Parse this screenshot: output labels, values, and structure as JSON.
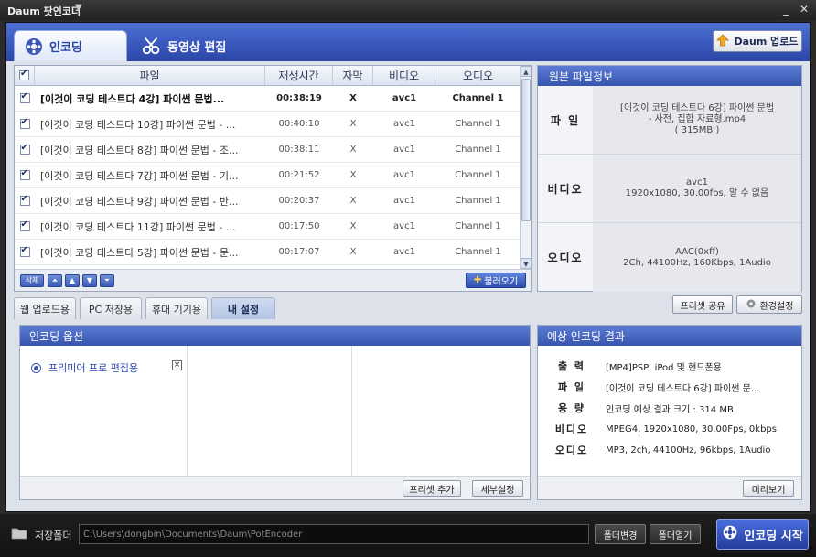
{
  "window": {
    "title": "Daum 팟인코더",
    "minimize": "_",
    "close": "✕"
  },
  "main_tabs": [
    {
      "label": "인코딩",
      "active": true
    },
    {
      "label": "동영상 편집",
      "active": false
    }
  ],
  "upload_button": "Daum 업로드",
  "file_list": {
    "columns": [
      "파일",
      "재생시간",
      "자막",
      "비디오",
      "오디오"
    ],
    "rows": [
      {
        "file": "[이것이 코딩 테스트다 4강] 파이썬 문법...",
        "time": "00:38:19",
        "sub": "X",
        "video": "avc1",
        "audio": "Channel 1",
        "checked": true,
        "bold": true
      },
      {
        "file": "[이것이 코딩 테스트다 10강] 파이썬 문법 - ...",
        "time": "00:40:10",
        "sub": "X",
        "video": "avc1",
        "audio": "Channel 1",
        "checked": true,
        "bold": false
      },
      {
        "file": "[이것이 코딩 테스트다 8강] 파이썬 문법 - 조...",
        "time": "00:38:11",
        "sub": "X",
        "video": "avc1",
        "audio": "Channel 1",
        "checked": true,
        "bold": false
      },
      {
        "file": "[이것이 코딩 테스트다 7강] 파이썬 문법 - 기...",
        "time": "00:21:52",
        "sub": "X",
        "video": "avc1",
        "audio": "Channel 1",
        "checked": true,
        "bold": false
      },
      {
        "file": "[이것이 코딩 테스트다 9강] 파이썬 문법 - 반...",
        "time": "00:20:37",
        "sub": "X",
        "video": "avc1",
        "audio": "Channel 1",
        "checked": true,
        "bold": false
      },
      {
        "file": "[이것이 코딩 테스트다 11강] 파이썬 문법 - ...",
        "time": "00:17:50",
        "sub": "X",
        "video": "avc1",
        "audio": "Channel 1",
        "checked": true,
        "bold": false
      },
      {
        "file": "[이것이 코딩 테스트다 5강] 파이썬 문법 - 문...",
        "time": "00:17:07",
        "sub": "X",
        "video": "avc1",
        "audio": "Channel 1",
        "checked": true,
        "bold": false
      }
    ],
    "delete_label": "삭제",
    "load_label": "불러오기"
  },
  "source_info": {
    "title": "원본 파일정보",
    "rows": [
      {
        "label": "파 일",
        "lines": [
          "[이것이 코딩 테스트다 6강] 파이썬 문법",
          "- 사전, 집합 자료형.mp4",
          "( 315MB )"
        ]
      },
      {
        "label": "비디오",
        "lines": [
          "avc1",
          "1920x1080, 30.00fps, 알 수 없음"
        ]
      },
      {
        "label": "오디오",
        "lines": [
          "AAC(0xff)",
          "2Ch, 44100Hz, 160Kbps, 1Audio"
        ]
      }
    ]
  },
  "sub_tabs": [
    {
      "label": "웹 업로드용",
      "active": false
    },
    {
      "label": "PC 저장용",
      "active": false
    },
    {
      "label": "휴대 기기용",
      "active": false
    },
    {
      "label": "내 설정",
      "active": true
    }
  ],
  "preset_share": "프리셋 공유",
  "settings": "환경설정",
  "encoding_options": {
    "title": "인코딩 옵션",
    "item": "프리미어 프로 편집용",
    "remove": "×",
    "add_preset": "프리셋 추가",
    "detail": "세부설정"
  },
  "expected": {
    "title": "예상 인코딩 결과",
    "rows": [
      {
        "label": "출 력",
        "value": "[MP4]PSP, iPod 및 핸드폰용"
      },
      {
        "label": "파 일",
        "value": "[이것이 코딩 테스트다 6강] 파이썬 문..."
      },
      {
        "label": "용 량",
        "value": "인코딩 예상 결과 크기 : 314 MB"
      },
      {
        "label": "비디오",
        "value": "MPEG4, 1920x1080, 30.00Fps, 0kbps"
      },
      {
        "label": "오디오",
        "value": "MP3, 2ch, 44100Hz, 96kbps, 1Audio"
      }
    ],
    "preview": "미리보기"
  },
  "bottom": {
    "folder_label": "저장폴더",
    "path": "C:\\Users\\dongbin\\Documents\\Daum\\PotEncoder",
    "change_folder": "폴더변경",
    "open_folder": "폴더열기",
    "start": "인코딩 시작"
  }
}
